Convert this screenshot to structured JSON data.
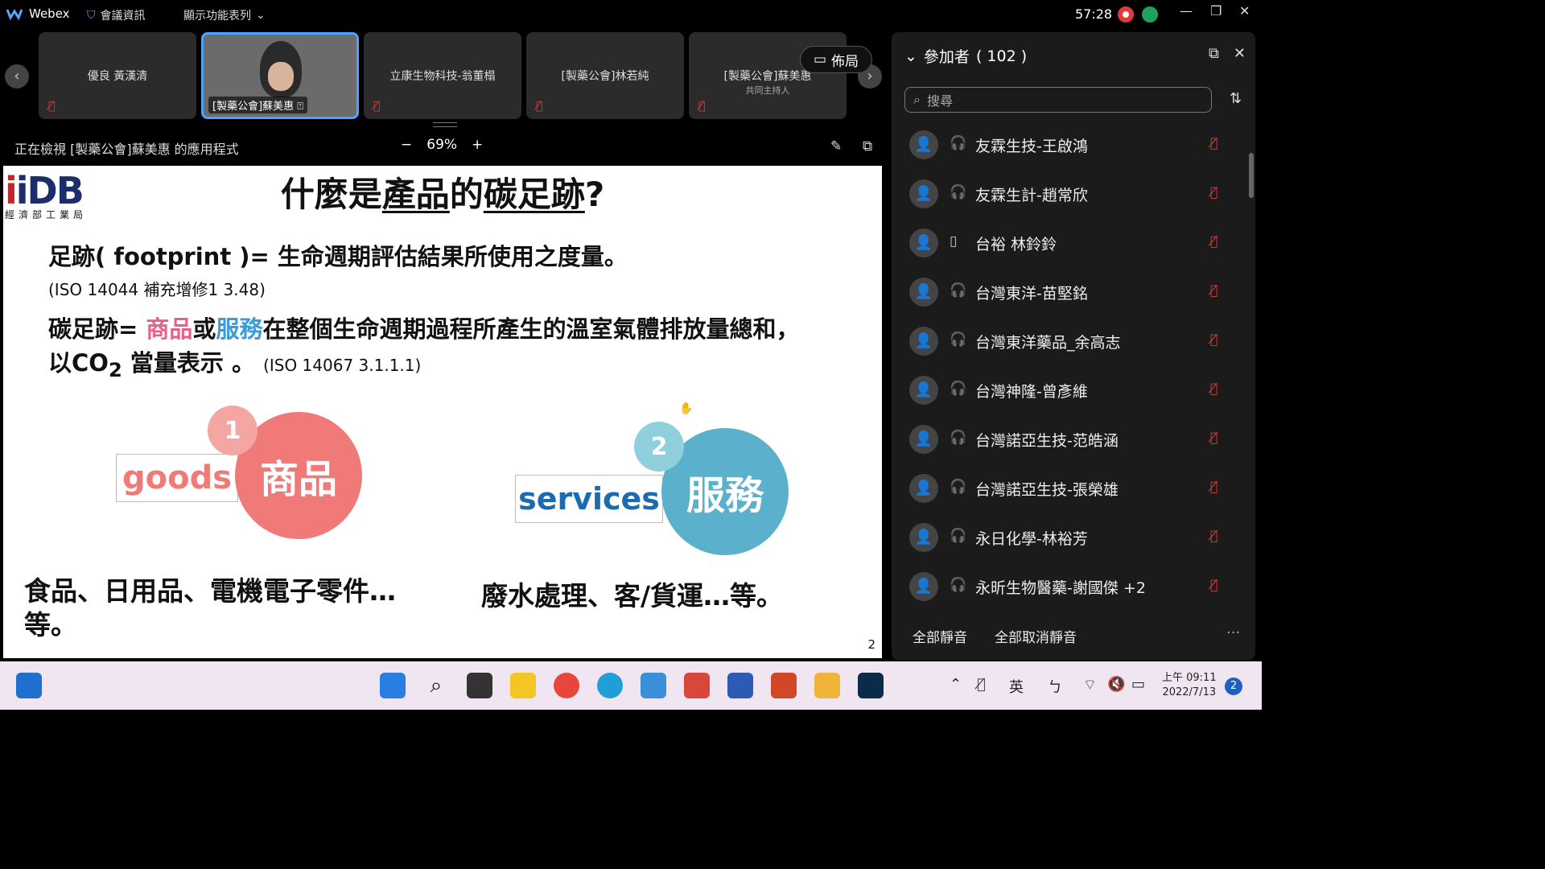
{
  "app": {
    "name": "Webex",
    "menu_meeting_info": "會議資訊",
    "menu_show_menu": "顯示功能表列",
    "timer": "57:28"
  },
  "thumbnails": {
    "tiles": [
      {
        "name": "優良 黃漢清",
        "sub": ""
      },
      {
        "name": "[製藥公會]蘇美惠",
        "sub": ""
      },
      {
        "name": "立康生物科技-翁董榻",
        "sub": ""
      },
      {
        "name": "[製藥公會]林若純",
        "sub": ""
      },
      {
        "name": "[製藥公會]蘇美惠",
        "sub": "共同主持人"
      }
    ],
    "layout_label": "佈局"
  },
  "viewer": {
    "status_text": "正在檢視 [製藥公會]蘇美惠 的應用程式",
    "zoom": "69%",
    "zoom_minus": "−",
    "zoom_plus": "+"
  },
  "slide": {
    "logo_text": "iDB",
    "logo_sub": "經濟部工業局",
    "title_pre": "什麼是",
    "title_u1": "產品",
    "title_mid": "的",
    "title_u2": "碳足跡",
    "title_end": "?",
    "def1": "足跡( footprint )= 生命週期評估結果所使用之度量。",
    "def1_ref": "(ISO 14044 補充增修1 3.48)",
    "def2_a": "碳足跡= ",
    "def2_goods": "商品",
    "def2_or": "或",
    "def2_services": "服務",
    "def2_b": "在整個生命週期過程所產生的溫室氣體排放量總和，",
    "def2_c1": "以CO",
    "def2_c_sub": "2",
    "def2_c2": " 當量表示 。",
    "def2_ref": "(ISO 14067 3.1.1.1)",
    "item1_num": "1",
    "item1_en": "goods",
    "item1_zh": "商品",
    "item2_num": "2",
    "item2_en": "services",
    "item2_zh": "服務",
    "examples1": "食品、日用品、電機電子零件…等。",
    "examples2": "廢水處理、客/貨運…等。",
    "page": "2"
  },
  "participants": {
    "title": "參加者",
    "count": "( 102 )",
    "search_placeholder": "搜尋",
    "list": [
      {
        "name": "友霖生技-王啟鴻",
        "device": "headset-icon"
      },
      {
        "name": "友霖生計-趙常欣",
        "device": "headset-icon"
      },
      {
        "name": "台裕 林鈴鈴",
        "device": "phone-icon"
      },
      {
        "name": "台灣東洋-苗堅銘",
        "device": "headset-icon"
      },
      {
        "name": "台灣東洋藥品_余高志",
        "device": "headset-icon"
      },
      {
        "name": "台灣神隆-曾彥維",
        "device": "headset-icon"
      },
      {
        "name": "台灣諾亞生技-范皓涵",
        "device": "headset-icon"
      },
      {
        "name": "台灣諾亞生技-張榮雄",
        "device": "headset-icon"
      },
      {
        "name": "永日化學-林裕芳",
        "device": "headset-icon"
      },
      {
        "name": "永昕生物醫藥-謝國傑 +2",
        "device": "headset-icon"
      }
    ],
    "mute_all": "全部靜音",
    "unmute_all": "全部取消靜音",
    "more": "···"
  },
  "taskbar": {
    "ime": "英",
    "ime2": "ㄅ",
    "time_period": "上午 09:11",
    "date": "2022/7/13",
    "notifications": "2"
  },
  "colors": {
    "accent_blue": "#4aa3ff",
    "goods_pink": "#f07a78",
    "services_blue": "#5bb0cc",
    "muted_red": "#e03a3a"
  }
}
